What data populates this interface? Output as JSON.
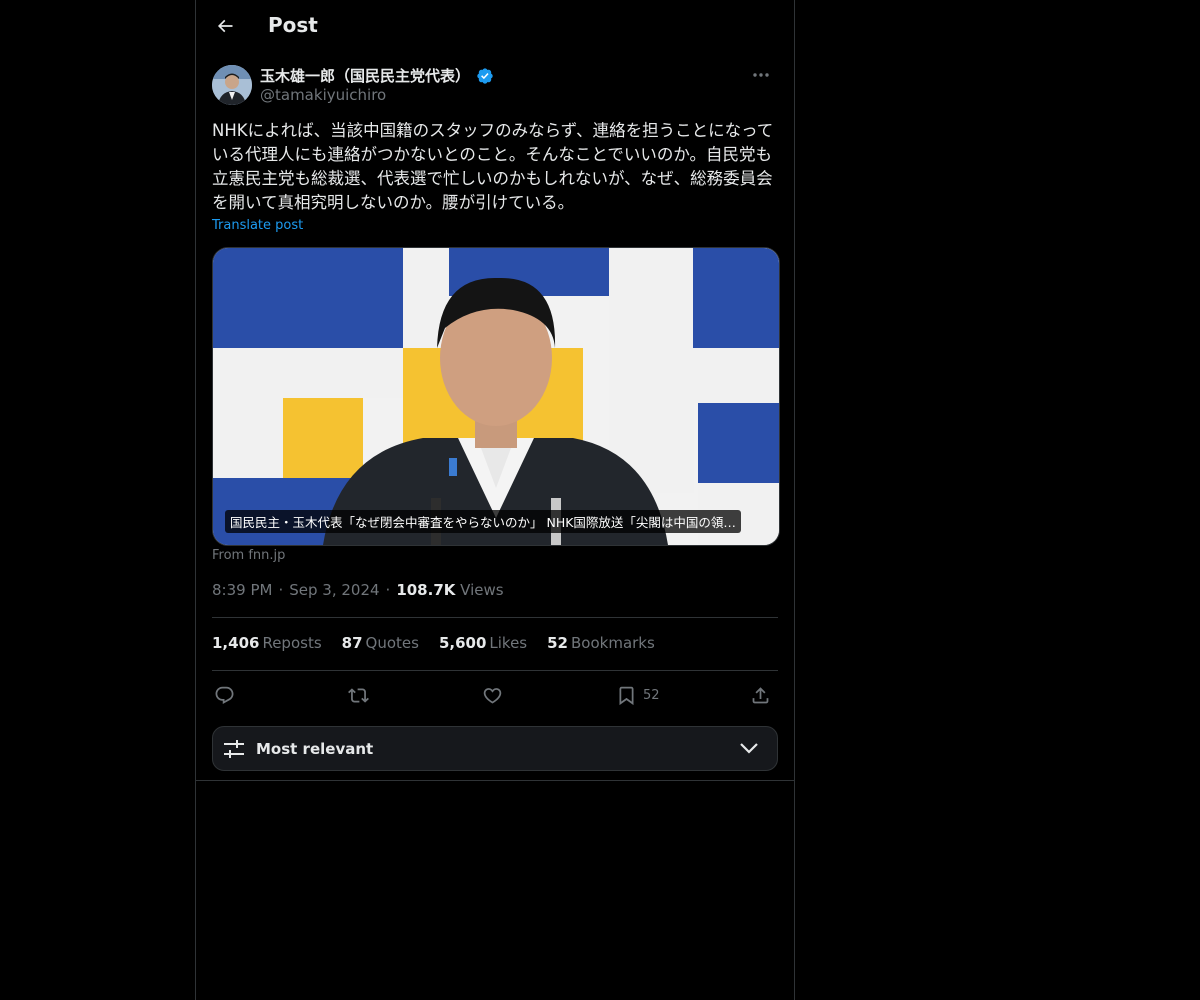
{
  "header": {
    "title": "Post"
  },
  "author": {
    "display_name": "玉木雄一郎（国民民主党代表）",
    "handle": "@tamakiyuichiro",
    "verified": true
  },
  "post": {
    "text": "NHKによれば、当該中国籍のスタッフのみならず、連絡を担うことになっている代理人にも連絡がつかないとのこと。そんなことでいいのか。自民党も立憲民主党も総裁選、代表選で忙しいのかもしれないが、なぜ、総務委員会を開いて真相究明しないのか。腰が引けている。",
    "translate_label": "Translate post",
    "media_caption": "国民民主・玉木代表「なぜ閉会中審査をやらないのか」 NHK国際放送「尖閣は中国の領…",
    "media_source": "From fnn.jp",
    "time": "8:39 PM",
    "date": "Sep 3, 2024",
    "views_count": "108.7K",
    "views_label": "Views"
  },
  "stats": [
    {
      "count": "1,406",
      "label": "Reposts"
    },
    {
      "count": "87",
      "label": "Quotes"
    },
    {
      "count": "5,600",
      "label": "Likes"
    },
    {
      "count": "52",
      "label": "Bookmarks"
    }
  ],
  "actions": {
    "bookmark_count": "52"
  },
  "sort": {
    "label": "Most relevant"
  },
  "colors": {
    "background": "#000000",
    "text": "#e7e9ea",
    "muted": "#71767b",
    "accent": "#1d9bf0",
    "border": "#2f3336"
  },
  "icons": [
    "back-arrow-icon",
    "verified-badge-icon",
    "more-icon",
    "reply-icon",
    "repost-icon",
    "like-icon",
    "bookmark-icon",
    "share-icon",
    "sort-sliders-icon",
    "chevron-down-icon"
  ]
}
